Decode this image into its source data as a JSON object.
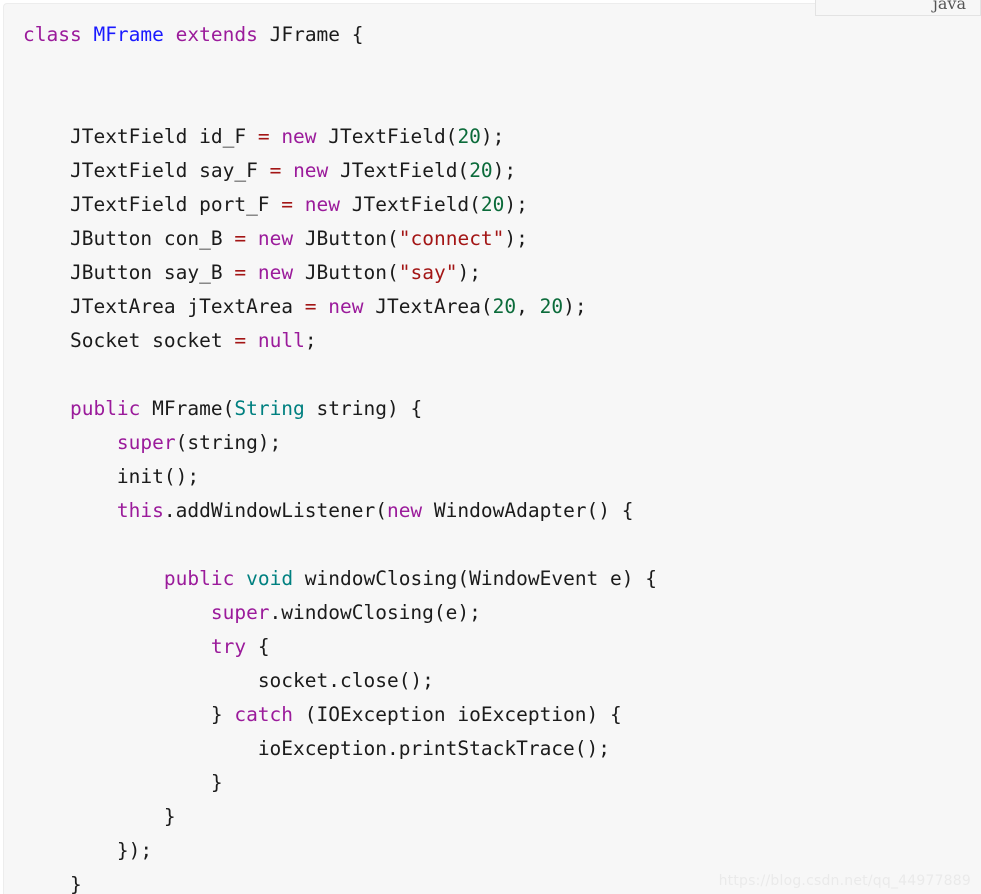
{
  "language_tab": {
    "label": "java"
  },
  "watermark": {
    "text": "https://blog.csdn.net/qq_44977889"
  },
  "colors": {
    "background": "#f7f7f7",
    "page_background": "#ffffff",
    "border": "#ededed",
    "keyword": "#9b1b9b",
    "type": "#008080",
    "class_name": "#1a1aff",
    "string": "#a31515",
    "number": "#0b6b3a",
    "operator": "#a31515",
    "plain": "#1b1b1b",
    "watermark": "#eaeaea"
  },
  "code": {
    "language": "java",
    "lines": [
      {
        "indent": 0,
        "tokens": [
          {
            "t": "class",
            "k": "kw"
          },
          {
            "t": " ",
            "k": "pl"
          },
          {
            "t": "MFrame",
            "k": "cls"
          },
          {
            "t": " ",
            "k": "pl"
          },
          {
            "t": "extends",
            "k": "kw"
          },
          {
            "t": " ",
            "k": "pl"
          },
          {
            "t": "JFrame",
            "k": "pl"
          },
          {
            "t": " {",
            "k": "pl"
          }
        ]
      },
      {
        "indent": 0,
        "tokens": []
      },
      {
        "indent": 0,
        "tokens": []
      },
      {
        "indent": 1,
        "tokens": [
          {
            "t": "JTextField id_F ",
            "k": "pl"
          },
          {
            "t": "=",
            "k": "op"
          },
          {
            "t": " ",
            "k": "pl"
          },
          {
            "t": "new",
            "k": "kw"
          },
          {
            "t": " JTextField(",
            "k": "pl"
          },
          {
            "t": "20",
            "k": "num"
          },
          {
            "t": ");",
            "k": "pl"
          }
        ]
      },
      {
        "indent": 1,
        "tokens": [
          {
            "t": "JTextField say_F ",
            "k": "pl"
          },
          {
            "t": "=",
            "k": "op"
          },
          {
            "t": " ",
            "k": "pl"
          },
          {
            "t": "new",
            "k": "kw"
          },
          {
            "t": " JTextField(",
            "k": "pl"
          },
          {
            "t": "20",
            "k": "num"
          },
          {
            "t": ");",
            "k": "pl"
          }
        ]
      },
      {
        "indent": 1,
        "tokens": [
          {
            "t": "JTextField port_F ",
            "k": "pl"
          },
          {
            "t": "=",
            "k": "op"
          },
          {
            "t": " ",
            "k": "pl"
          },
          {
            "t": "new",
            "k": "kw"
          },
          {
            "t": " JTextField(",
            "k": "pl"
          },
          {
            "t": "20",
            "k": "num"
          },
          {
            "t": ");",
            "k": "pl"
          }
        ]
      },
      {
        "indent": 1,
        "tokens": [
          {
            "t": "JButton con_B ",
            "k": "pl"
          },
          {
            "t": "=",
            "k": "op"
          },
          {
            "t": " ",
            "k": "pl"
          },
          {
            "t": "new",
            "k": "kw"
          },
          {
            "t": " JButton(",
            "k": "pl"
          },
          {
            "t": "\"connect\"",
            "k": "str"
          },
          {
            "t": ");",
            "k": "pl"
          }
        ]
      },
      {
        "indent": 1,
        "tokens": [
          {
            "t": "JButton say_B ",
            "k": "pl"
          },
          {
            "t": "=",
            "k": "op"
          },
          {
            "t": " ",
            "k": "pl"
          },
          {
            "t": "new",
            "k": "kw"
          },
          {
            "t": " JButton(",
            "k": "pl"
          },
          {
            "t": "\"say\"",
            "k": "str"
          },
          {
            "t": ");",
            "k": "pl"
          }
        ]
      },
      {
        "indent": 1,
        "tokens": [
          {
            "t": "JTextArea jTextArea ",
            "k": "pl"
          },
          {
            "t": "=",
            "k": "op"
          },
          {
            "t": " ",
            "k": "pl"
          },
          {
            "t": "new",
            "k": "kw"
          },
          {
            "t": " JTextArea(",
            "k": "pl"
          },
          {
            "t": "20",
            "k": "num"
          },
          {
            "t": ", ",
            "k": "pl"
          },
          {
            "t": "20",
            "k": "num"
          },
          {
            "t": ");",
            "k": "pl"
          }
        ]
      },
      {
        "indent": 1,
        "tokens": [
          {
            "t": "Socket socket ",
            "k": "pl"
          },
          {
            "t": "=",
            "k": "op"
          },
          {
            "t": " ",
            "k": "pl"
          },
          {
            "t": "null",
            "k": "kw"
          },
          {
            "t": ";",
            "k": "pl"
          }
        ]
      },
      {
        "indent": 0,
        "tokens": []
      },
      {
        "indent": 1,
        "tokens": [
          {
            "t": "public",
            "k": "kw"
          },
          {
            "t": " MFrame(",
            "k": "pl"
          },
          {
            "t": "String",
            "k": "type"
          },
          {
            "t": " string) {",
            "k": "pl"
          }
        ]
      },
      {
        "indent": 2,
        "tokens": [
          {
            "t": "super",
            "k": "kw"
          },
          {
            "t": "(string);",
            "k": "pl"
          }
        ]
      },
      {
        "indent": 2,
        "tokens": [
          {
            "t": "init();",
            "k": "pl"
          }
        ]
      },
      {
        "indent": 2,
        "tokens": [
          {
            "t": "this",
            "k": "kw"
          },
          {
            "t": ".addWindowListener(",
            "k": "pl"
          },
          {
            "t": "new",
            "k": "kw"
          },
          {
            "t": " WindowAdapter() {",
            "k": "pl"
          }
        ]
      },
      {
        "indent": 0,
        "tokens": []
      },
      {
        "indent": 3,
        "tokens": [
          {
            "t": "public",
            "k": "kw"
          },
          {
            "t": " ",
            "k": "pl"
          },
          {
            "t": "void",
            "k": "type"
          },
          {
            "t": " windowClosing(WindowEvent e) {",
            "k": "pl"
          }
        ]
      },
      {
        "indent": 4,
        "tokens": [
          {
            "t": "super",
            "k": "kw"
          },
          {
            "t": ".windowClosing(e);",
            "k": "pl"
          }
        ]
      },
      {
        "indent": 4,
        "tokens": [
          {
            "t": "try",
            "k": "kw"
          },
          {
            "t": " {",
            "k": "pl"
          }
        ]
      },
      {
        "indent": 5,
        "tokens": [
          {
            "t": "socket.close();",
            "k": "pl"
          }
        ]
      },
      {
        "indent": 4,
        "tokens": [
          {
            "t": "} ",
            "k": "pl"
          },
          {
            "t": "catch",
            "k": "kw"
          },
          {
            "t": " (IOException ioException) {",
            "k": "pl"
          }
        ]
      },
      {
        "indent": 5,
        "tokens": [
          {
            "t": "ioException.printStackTrace();",
            "k": "pl"
          }
        ]
      },
      {
        "indent": 4,
        "tokens": [
          {
            "t": "}",
            "k": "pl"
          }
        ]
      },
      {
        "indent": 3,
        "tokens": [
          {
            "t": "}",
            "k": "pl"
          }
        ]
      },
      {
        "indent": 2,
        "tokens": [
          {
            "t": "});",
            "k": "pl"
          }
        ]
      },
      {
        "indent": 1,
        "tokens": [
          {
            "t": "}",
            "k": "pl"
          }
        ]
      }
    ]
  }
}
